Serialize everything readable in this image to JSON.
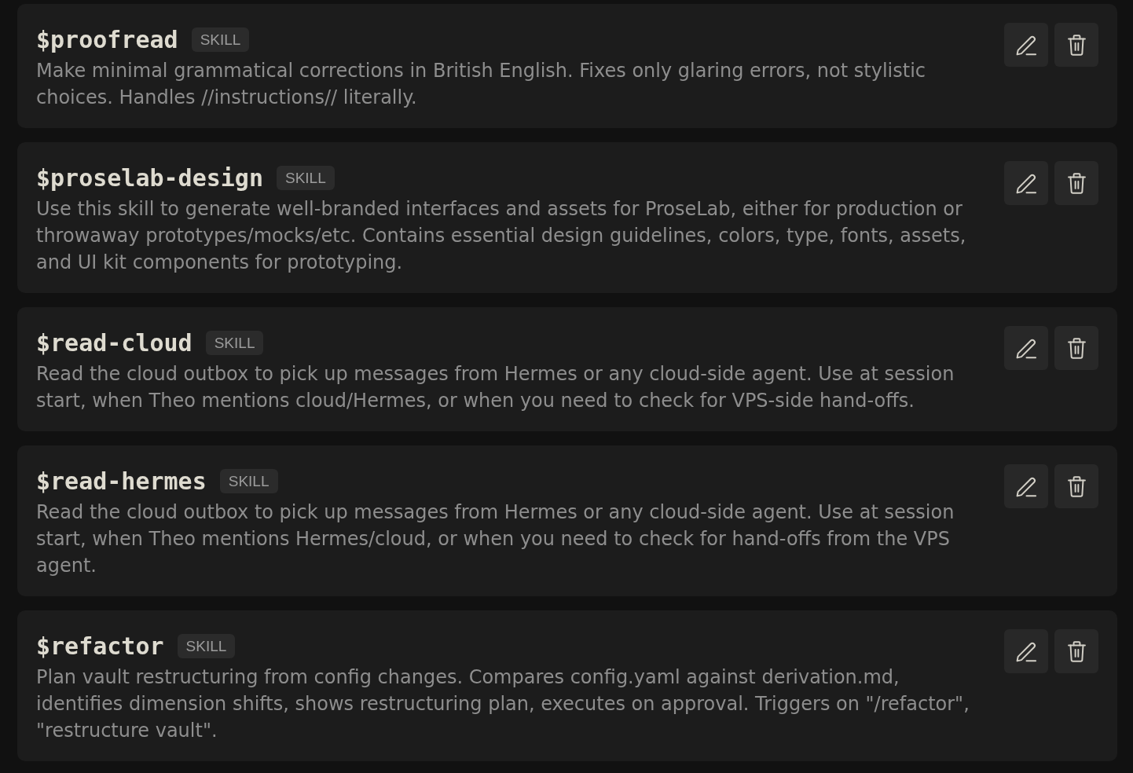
{
  "skills": [
    {
      "name": "$proofread",
      "tag": "SKILL",
      "description": "Make minimal grammatical corrections in British English. Fixes only glaring errors, not stylistic choices. Handles //instructions// literally."
    },
    {
      "name": "$proselab-design",
      "tag": "SKILL",
      "description": "Use this skill to generate well-branded interfaces and assets for ProseLab, either for production or throwaway prototypes/mocks/etc. Contains essential design guidelines, colors, type, fonts, assets, and UI kit components for prototyping."
    },
    {
      "name": "$read-cloud",
      "tag": "SKILL",
      "description": "Read the cloud outbox to pick up messages from Hermes or any cloud-side agent. Use at session start, when Theo mentions cloud/Hermes, or when you need to check for VPS-side hand-offs."
    },
    {
      "name": "$read-hermes",
      "tag": "SKILL",
      "description": "Read the cloud outbox to pick up messages from Hermes or any cloud-side agent. Use at session start, when Theo mentions Hermes/cloud, or when you need to check for hand-offs from the VPS agent."
    },
    {
      "name": "$refactor",
      "tag": "SKILL",
      "description": "Plan vault restructuring from config changes. Compares config.yaml against derivation.md, identifies dimension shifts, shows restructuring plan, executes on approval. Triggers on \"/refactor\", \"restructure vault\"."
    }
  ]
}
